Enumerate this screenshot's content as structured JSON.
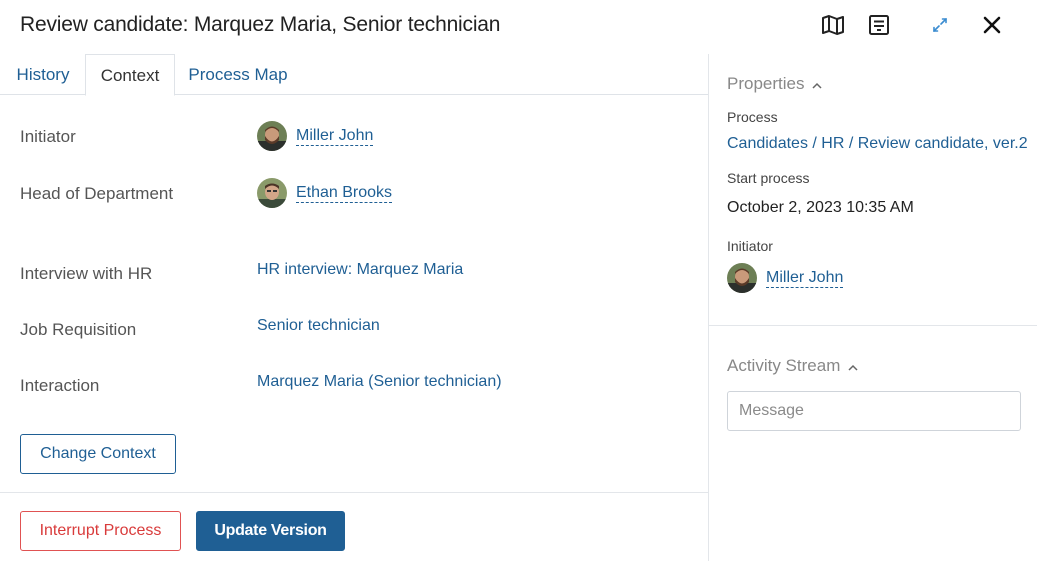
{
  "header": {
    "title": "Review candidate: Marquez Maria, Senior technician",
    "icons": [
      "map-icon",
      "form-icon",
      "expand-icon",
      "close-icon"
    ]
  },
  "tabs": [
    {
      "label": "History",
      "active": false
    },
    {
      "label": "Context",
      "active": true
    },
    {
      "label": "Process Map",
      "active": false
    }
  ],
  "context": {
    "initiator_label": "Initiator",
    "initiator_name": "Miller John",
    "head_label": "Head of Department",
    "head_name": "Ethan Brooks",
    "interview_label": "Interview with HR",
    "interview_value": "HR interview: Marquez Maria",
    "job_label": "Job Requisition",
    "job_value": "Senior technician",
    "interaction_label": "Interaction",
    "interaction_value": "Marquez Maria (Senior technician)",
    "change_context_label": "Change Context"
  },
  "footer": {
    "interrupt_label": "Interrupt Process",
    "update_label": "Update Version"
  },
  "properties": {
    "heading": "Properties",
    "process_label": "Process",
    "process_value": "Candidates / HR / Review candidate, ver.2",
    "start_label": "Start process",
    "start_value": "October 2, 2023 10:35 AM",
    "initiator_label": "Initiator",
    "initiator_name": "Miller John"
  },
  "activity": {
    "heading": "Activity Stream",
    "message_placeholder": "Message"
  },
  "colors": {
    "link": "#1f5f94",
    "primary": "#1f5f94",
    "danger": "#d93b3b"
  }
}
